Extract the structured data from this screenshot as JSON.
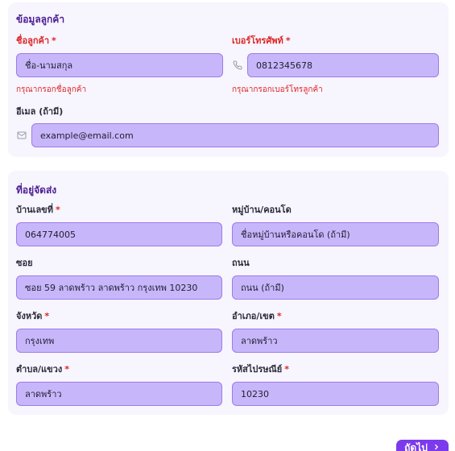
{
  "customer": {
    "title": "ข้อมูลลูกค้า",
    "name": {
      "label": "ชื่อลูกค้า",
      "placeholder": "ชื่อ-นามสกุล",
      "error": "กรุณากรอกชื่อลูกค้า"
    },
    "phone": {
      "label": "เบอร์โทรศัพท์",
      "value": "0812345678",
      "error": "กรุณากรอกเบอร์โทรลูกค้า"
    },
    "email": {
      "label": "อีเมล (ถ้ามี)",
      "placeholder": "example@email.com"
    }
  },
  "shipping": {
    "title": "ที่อยู่จัดส่ง",
    "house_no": {
      "label": "บ้านเลขที่",
      "value": "064774005"
    },
    "village": {
      "label": "หมู่บ้าน/คอนโด",
      "placeholder": "ชื่อหมู่บ้านหรือคอนโด (ถ้ามี)"
    },
    "soi": {
      "label": "ซอย",
      "value": "ซอย 59 ลาดพร้าว ลาดพร้าว กรุงเทพ 10230"
    },
    "road": {
      "label": "ถนน",
      "placeholder": "ถนน (ถ้ามี)"
    },
    "province": {
      "label": "จังหวัด",
      "value": "กรุงเทพ"
    },
    "district": {
      "label": "อำเภอ/เขต",
      "value": "ลาดพร้าว"
    },
    "subdistrict": {
      "label": "ตำบล/แขวง",
      "value": "ลาดพร้าว"
    },
    "postcode": {
      "label": "รหัสไปรษณีย์",
      "value": "10230"
    }
  },
  "required_mark": "*",
  "next_button": {
    "label": "ถัดไป",
    "icon": "chevron-right-icon"
  },
  "colors": {
    "accent": "#7c3aed",
    "input_bg": "#c8b6fb",
    "error": "#dc2626",
    "title": "#4c1d95"
  }
}
